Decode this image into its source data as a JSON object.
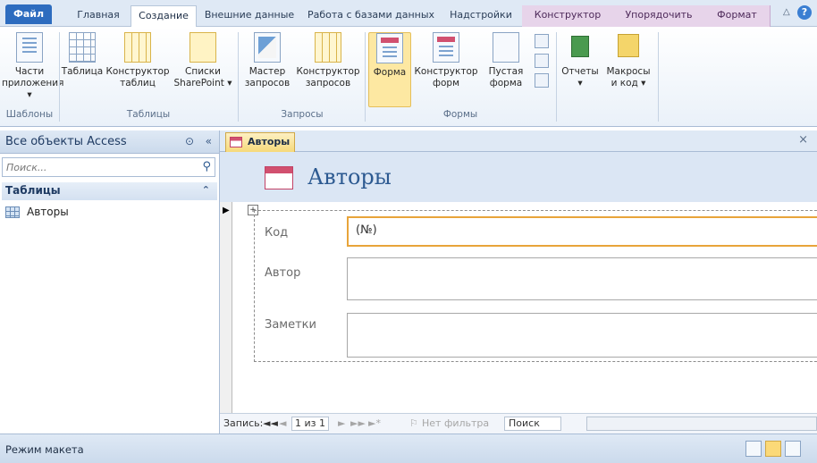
{
  "tabs": {
    "file": "Файл",
    "home": "Главная",
    "create": "Создание",
    "external": "Внешние данные",
    "database": "Работа с базами данных",
    "addins": "Надстройки",
    "design": "Конструктор",
    "arrange": "Упорядочить",
    "format": "Формат"
  },
  "ribbon": {
    "templates": {
      "app_parts_line1": "Части",
      "app_parts_line2": "приложения ▾",
      "group": "Шаблоны"
    },
    "tables": {
      "table": "Таблица",
      "table_design_line1": "Конструктор",
      "table_design_line2": "таблиц",
      "sharepoint_line1": "Списки",
      "sharepoint_line2": "SharePoint ▾",
      "group": "Таблицы"
    },
    "queries": {
      "wizard_line1": "Мастер",
      "wizard_line2": "запросов",
      "design_line1": "Конструктор",
      "design_line2": "запросов",
      "group": "Запросы"
    },
    "forms": {
      "form": "Форма",
      "form_design_line1": "Конструктор",
      "form_design_line2": "форм",
      "blank_line1": "Пустая",
      "blank_line2": "форма",
      "group": "Формы"
    },
    "reports": {
      "label_line1": "Отчеты",
      "label_line2": "▾"
    },
    "macros": {
      "label_line1": "Макросы",
      "label_line2": "и код ▾"
    }
  },
  "nav": {
    "header": "Все объекты Access",
    "search_placeholder": "Поиск...",
    "section": "Таблицы",
    "items": [
      {
        "label": "Авторы"
      }
    ]
  },
  "document": {
    "tab_label": "Авторы",
    "form_title": "Авторы",
    "fields": [
      {
        "label": "Код",
        "value": "(№)"
      },
      {
        "label": "Автор",
        "value": ""
      },
      {
        "label": "Заметки",
        "value": ""
      }
    ]
  },
  "record_nav": {
    "label": "Запись:",
    "first": "◄◄",
    "prev": "◄",
    "position": "1 из 1",
    "next": "►",
    "last": "►►",
    "new": "►*",
    "filter": "Нет фильтра",
    "search": "Поиск"
  },
  "status": {
    "text": "Режим макета"
  },
  "colors": {
    "accent": "#2d6cbf",
    "context_tab": "#e7d4ea",
    "selection": "#fde8a2",
    "focus_border": "#e8a43a"
  }
}
